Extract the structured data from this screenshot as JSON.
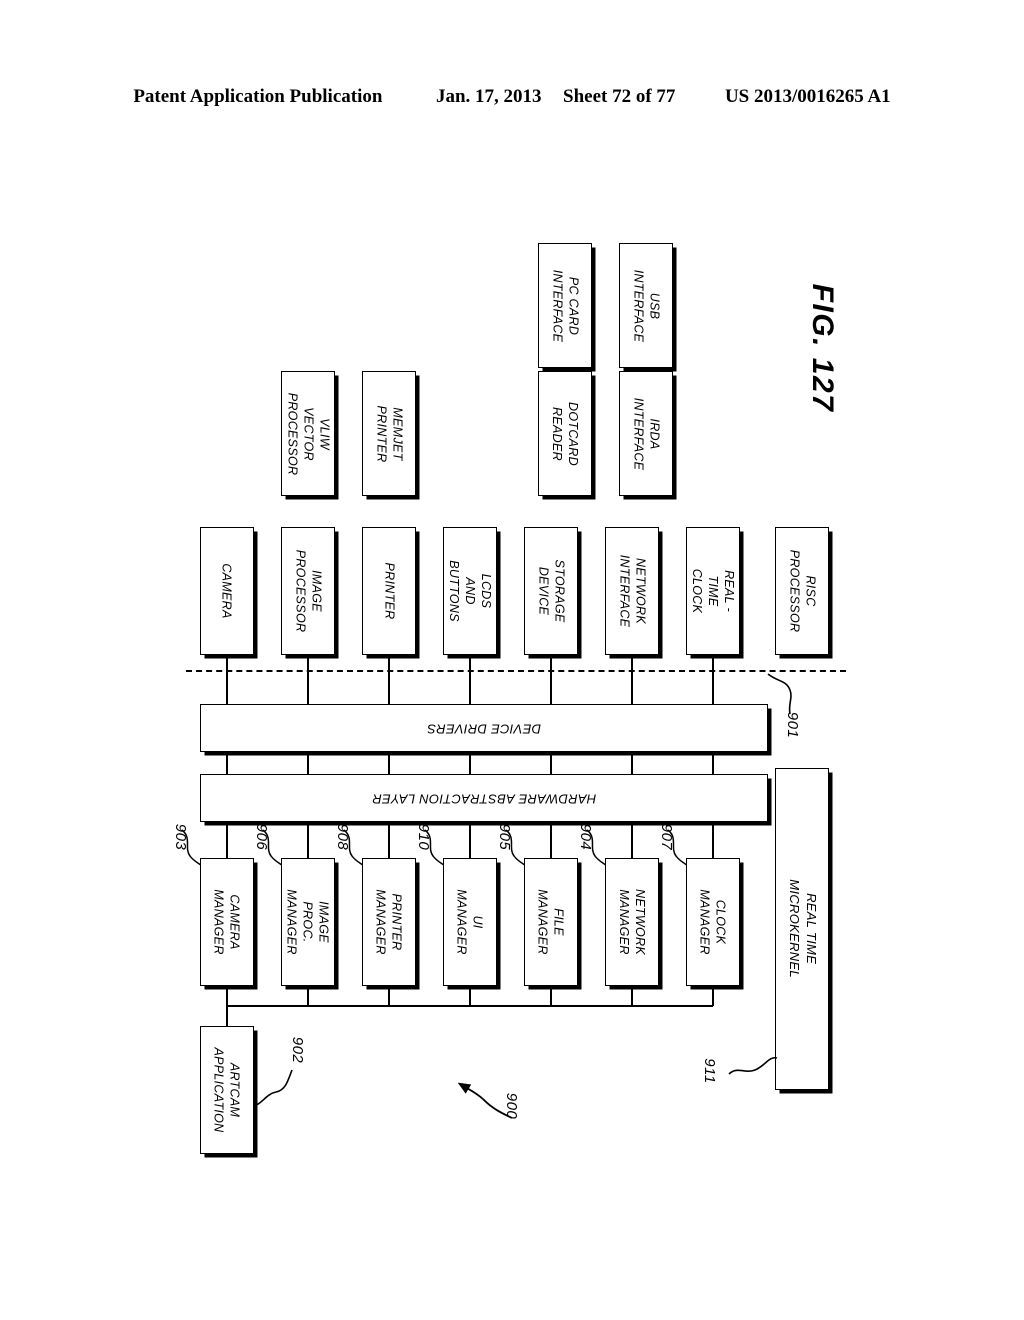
{
  "header": {
    "publication": "Patent Application Publication",
    "date": "Jan. 17, 2013",
    "sheet": "Sheet 72 of 77",
    "docnum": "US 2013/0016265 A1"
  },
  "figure": {
    "caption": "FIG. 127",
    "system_ref": "900"
  },
  "device_row": [
    {
      "label": "CAMERA"
    },
    {
      "label": "IMAGE\nPROCESSOR"
    },
    {
      "label": "PRINTER"
    },
    {
      "label": "LCDS AND\nBUTTONS"
    },
    {
      "label": "STORAGE\nDEVICE"
    },
    {
      "label": "NETWORK\nINTERFACE"
    },
    {
      "label": "REAL -TIME\nCLOCK"
    },
    {
      "label": "RISC\nPROCESSOR"
    }
  ],
  "peripheral_row_1": [
    {
      "label": "VLIW VECTOR\nPROCESSOR"
    },
    {
      "label": "MEMJET\nPRINTER"
    },
    {
      "label": "DOTCARD\nREADER"
    },
    {
      "label": "IRDA\nINTERFACE"
    }
  ],
  "peripheral_row_2": [
    {
      "label": "PC CARD\nINTERFACE"
    },
    {
      "label": "USB\nINTERFACE"
    }
  ],
  "layers": {
    "device_drivers": {
      "label": "DEVICE DRIVERS",
      "ref": "901"
    },
    "hal": {
      "label": "HARDWARE ABSTRACTION LAYER"
    }
  },
  "managers": [
    {
      "label": "CAMERA\nMANAGER",
      "ref": "903"
    },
    {
      "label": "IMAGE PROC.\nMANAGER",
      "ref": "906"
    },
    {
      "label": "PRINTER\nMANAGER",
      "ref": "908"
    },
    {
      "label": "UI\nMANAGER",
      "ref": "910"
    },
    {
      "label": "FILE\nMANAGER",
      "ref": "905"
    },
    {
      "label": "NETWORK\nMANAGER",
      "ref": "904"
    },
    {
      "label": "CLOCK\nMANAGER",
      "ref": "907"
    }
  ],
  "application": {
    "label": "ARTCAM\nAPPLICATION",
    "ref": "902"
  },
  "microkernel": {
    "label": "REAL TIME MICROKERNEL",
    "ref": "911"
  }
}
